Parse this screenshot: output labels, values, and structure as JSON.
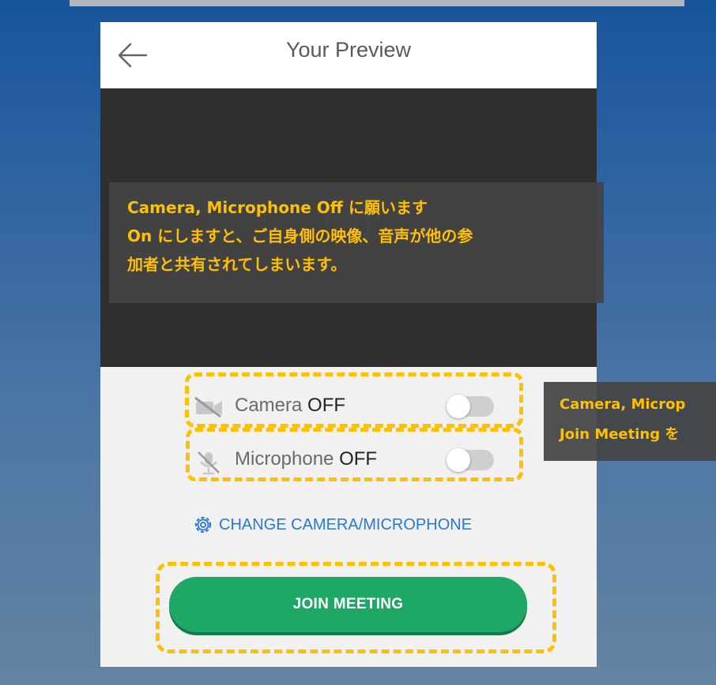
{
  "header": {
    "title": "Your Preview"
  },
  "camera": {
    "label": "Camera",
    "state": "OFF"
  },
  "microphone": {
    "label": "Microphone",
    "state": "OFF"
  },
  "change_link": {
    "label": "CHANGE CAMERA/MICROPHONE"
  },
  "join_button": {
    "label": "JOIN MEETING"
  },
  "notes": {
    "video_note": {
      "line1": "Camera, Microphone Off に願います",
      "line2": "On にしますと、ご自身側の映像、音声が他の参",
      "line3": "加者と共有されてしまいます。"
    },
    "side_note": {
      "line1": "Camera, Microp",
      "line2": "Join Meeting を"
    }
  },
  "colors": {
    "accent": "#1fa766",
    "link": "#2878d8",
    "highlight": "#ffc000"
  },
  "icons": [
    "back-arrow-icon",
    "camera-off-icon",
    "microphone-off-icon",
    "gear-icon"
  ]
}
